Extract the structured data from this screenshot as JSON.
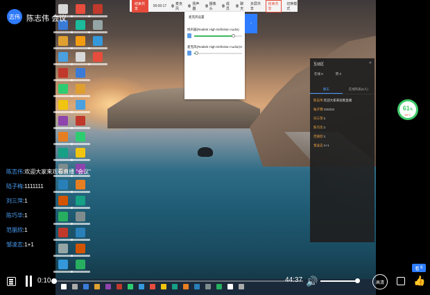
{
  "header": {
    "avatar_text": "志伟",
    "title": "陈志伟 会议"
  },
  "toolbar": {
    "record_label": "结束共享",
    "time": "00:00:17",
    "items": [
      "麦克风",
      "扬声器",
      "摄像头",
      "成员",
      "聊天",
      "多屏共享"
    ],
    "highlight_button": "结束共享",
    "extra_button": "切换模式"
  },
  "audio_panel": {
    "title": "麦克风设置",
    "speaker_label": "扬声器(Realtek High Definition Audio)",
    "mic_label": "麦克风(Realtek High Definition Audio(SST))",
    "speaker_level": 0.82,
    "mic_level": 0.05
  },
  "blue_tab_label": "",
  "interaction_panel": {
    "title": "互动区",
    "close": "✕",
    "stat_people": "在线 6",
    "stat_likes": "赞 0",
    "tabs": [
      "聊天",
      "在线列表(6人)"
    ],
    "active_tab": 0,
    "messages": [
      {
        "user": "陈志伟:",
        "text": "欢迎大家来观看直播"
      },
      {
        "user": "陆子霖:",
        "text": "1111111"
      },
      {
        "user": "刘三萍:",
        "text": "1"
      },
      {
        "user": "陈巧华:",
        "text": "1"
      },
      {
        "user": "范丽欣:",
        "text": "1"
      },
      {
        "user": "邹凌志:",
        "text": "1+1"
      }
    ]
  },
  "chat": [
    {
      "user": "陈志伟",
      "text": "欢迎大家来观看直播 “会议”"
    },
    {
      "user": "陆子梅",
      "text": "1111111"
    },
    {
      "user": "刘三萍",
      "text": "1"
    },
    {
      "user": "陈巧华",
      "text": "1"
    },
    {
      "user": "范丽欣",
      "text": "1"
    },
    {
      "user": "邹凌志",
      "text": "1+1"
    }
  ],
  "perf": {
    "value": "61",
    "unit": "%",
    "temp": "59°C"
  },
  "watchers": "6",
  "player": {
    "current_time": "0:10",
    "total_time": "44:37",
    "progress": 0.004,
    "volume": 0.95,
    "quality_label": "高清"
  },
  "colors": {
    "accent": "#2e7dff",
    "record_red": "#e64b3b",
    "chat_user": "#4da3ff",
    "perf_green": "#3fc96a"
  }
}
